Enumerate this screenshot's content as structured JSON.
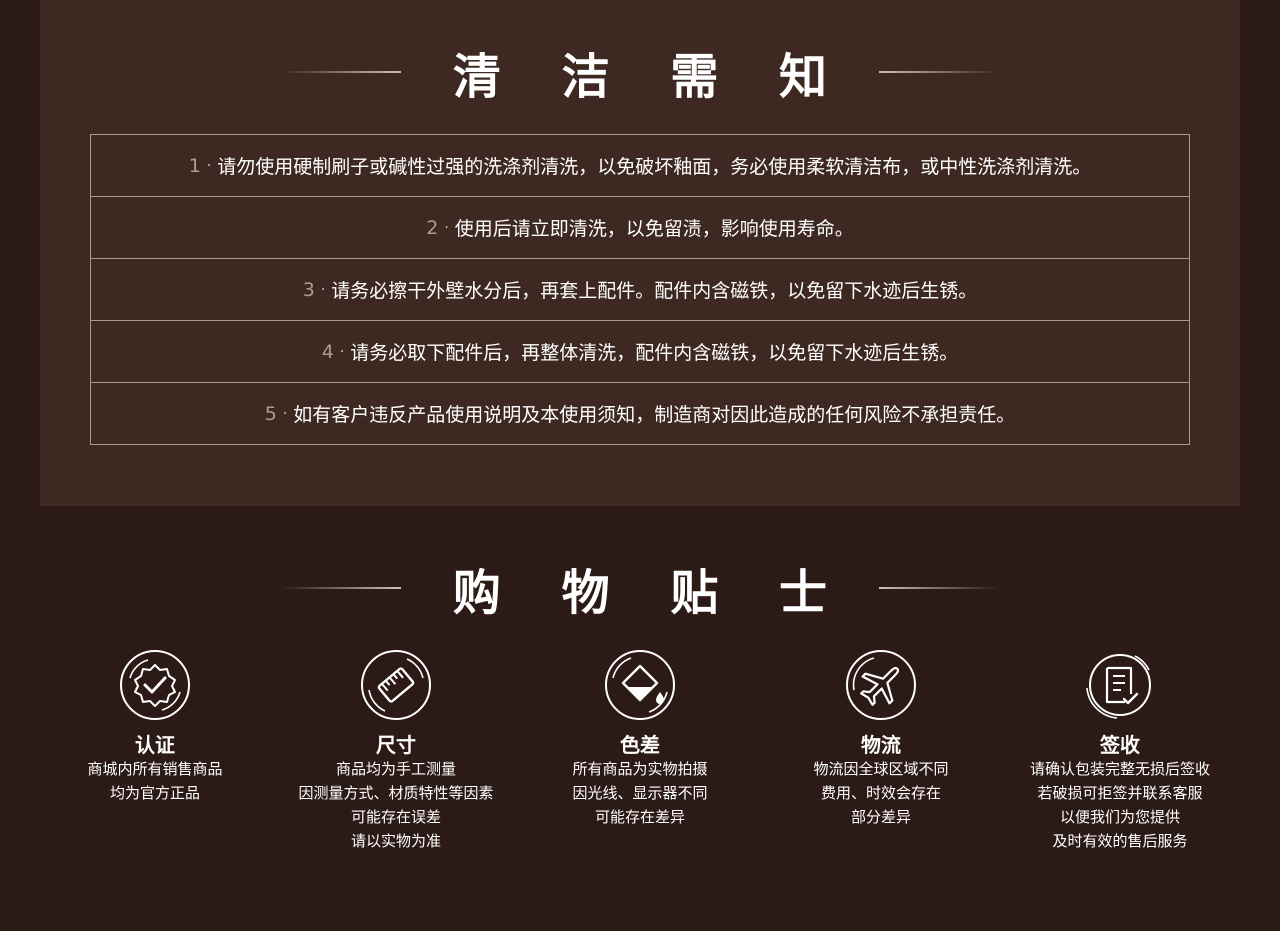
{
  "care": {
    "title": "清 洁 需 知",
    "rules": [
      {
        "num": "1",
        "dot": "·",
        "text": "请勿使用硬制刷子或碱性过强的洗涤剂清洗，以免破坏釉面，务必使用柔软清洁布，或中性洗涤剂清洗。"
      },
      {
        "num": "2",
        "dot": "·",
        "text": "使用后请立即清洗，以免留渍，影响使用寿命。"
      },
      {
        "num": "3",
        "dot": "·",
        "text": "请务必擦干外壁水分后，再套上配件。配件内含磁铁，以免留下水迹后生锈。"
      },
      {
        "num": "4",
        "dot": "·",
        "text": "请务必取下配件后，再整体清洗，配件内含磁铁，以免留下水迹后生锈。"
      },
      {
        "num": "5",
        "dot": "·",
        "text": "如有客户违反产品使用说明及本使用须知，制造商对因此造成的任何风险不承担责任。"
      }
    ]
  },
  "shop": {
    "title": "购 物 贴 士",
    "tips": [
      {
        "icon": "certified-badge-icon",
        "title": "认证",
        "lines": [
          "商城内所有销售商品",
          "均为官方正品"
        ]
      },
      {
        "icon": "ruler-icon",
        "title": "尺寸",
        "lines": [
          "商品均为手工测量",
          "因测量方式、材质特性等因素",
          "可能存在误差",
          "请以实物为准"
        ]
      },
      {
        "icon": "color-drop-icon",
        "title": "色差",
        "lines": [
          "所有商品为实物拍摄",
          "因光线、显示器不同",
          "可能存在差异"
        ]
      },
      {
        "icon": "airplane-icon",
        "title": "物流",
        "lines": [
          "物流因全球区域不同",
          "费用、时效会存在",
          "部分差异"
        ]
      },
      {
        "icon": "document-check-icon",
        "title": "签收",
        "lines": [
          "请确认包装完整无损后签收",
          "若破损可拒签并联系客服",
          "以便我们为您提供",
          "及时有效的售后服务"
        ]
      }
    ]
  },
  "colors": {
    "page_bg": "#2b1a15",
    "panel_bg": "#3d2822",
    "border": "#a89a91",
    "text": "#ffffff"
  }
}
